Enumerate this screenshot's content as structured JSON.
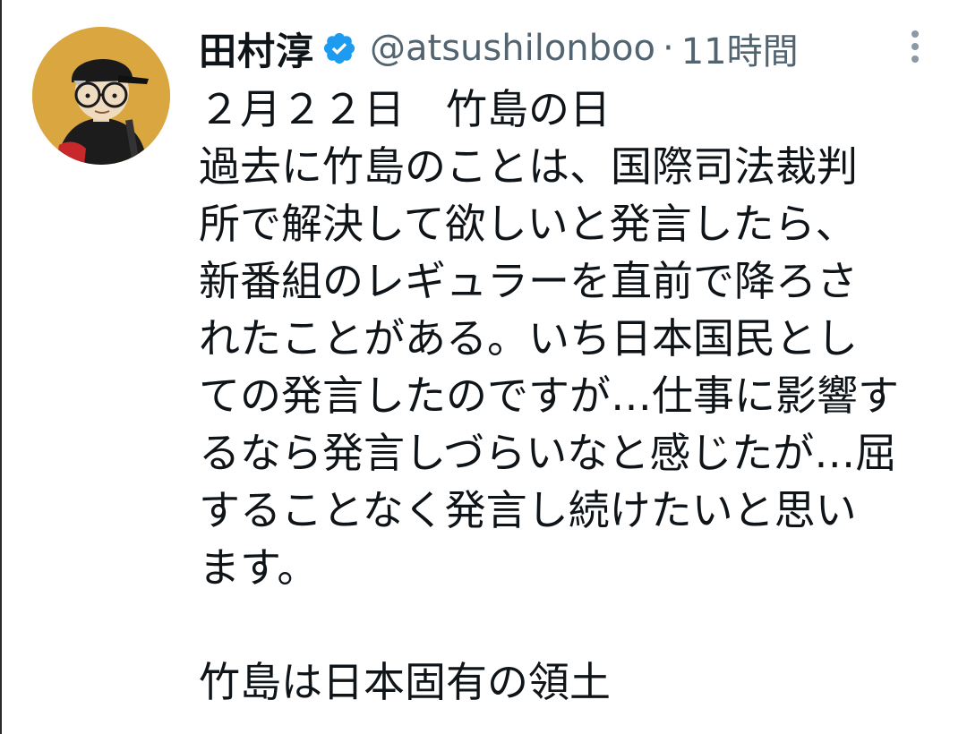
{
  "author": {
    "display_name": "田村淳",
    "handle": "@atsushilonboo",
    "separator": "·",
    "time": "11時間",
    "verified": true,
    "verified_color": "#1d9bf0"
  },
  "menu": {
    "icon": "more-vertical-icon"
  },
  "tweet": {
    "lines": [
      "２月２２日　竹島の日",
      "過去に竹島のことは、国際司法裁判",
      "所で解決して欲しいと発言したら、",
      "新番組のレギュラーを直前で降ろさ",
      "れたことがある。いち日本国民とし",
      "ての発言したのですが…仕事に影響す",
      "るなら発言しづらいなと感じたが…屈",
      "することなく発言し続けたいと思い",
      "ます。",
      "",
      "竹島は日本固有の領土"
    ]
  }
}
